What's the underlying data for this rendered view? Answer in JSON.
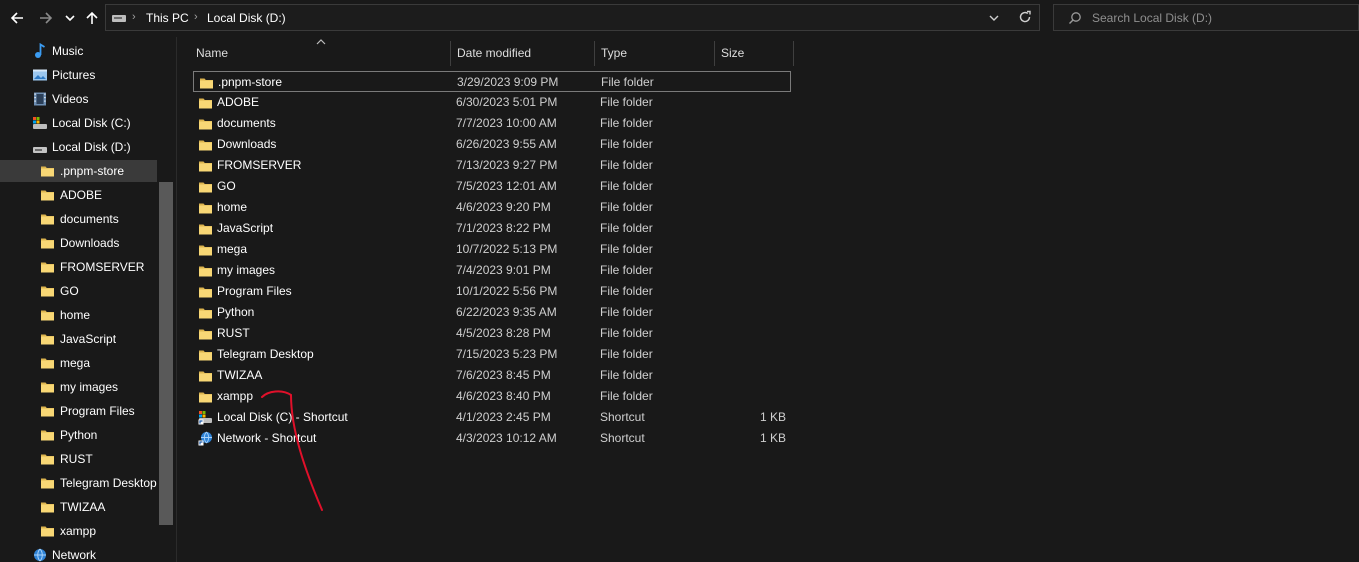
{
  "toolbar": {
    "back_icon": "arrow-left-icon",
    "forward_icon": "arrow-right-icon",
    "recent_icon": "chevron-down-icon",
    "up_icon": "arrow-up-icon"
  },
  "address_bar": {
    "crumbs": [
      "This PC",
      "Local Disk (D:)"
    ],
    "dropdown_icon": "chevron-down-icon",
    "refresh_icon": "refresh-icon"
  },
  "search": {
    "placeholder": "Search Local Disk (D:)"
  },
  "sidebar": {
    "items": [
      {
        "label": "Music",
        "icon": "music-icon",
        "level": 1
      },
      {
        "label": "Pictures",
        "icon": "pictures-icon",
        "level": 1
      },
      {
        "label": "Videos",
        "icon": "videos-icon",
        "level": 1
      },
      {
        "label": "Local Disk (C:)",
        "icon": "drive-c-icon",
        "level": 1
      },
      {
        "label": "Local Disk (D:)",
        "icon": "drive-icon",
        "level": 1
      },
      {
        "label": ".pnpm-store",
        "icon": "folder-icon",
        "level": 2,
        "selected": true
      },
      {
        "label": "ADOBE",
        "icon": "folder-icon",
        "level": 2
      },
      {
        "label": "documents",
        "icon": "folder-icon",
        "level": 2
      },
      {
        "label": "Downloads",
        "icon": "folder-icon",
        "level": 2
      },
      {
        "label": "FROMSERVER",
        "icon": "folder-icon",
        "level": 2
      },
      {
        "label": "GO",
        "icon": "folder-icon",
        "level": 2
      },
      {
        "label": "home",
        "icon": "folder-icon",
        "level": 2
      },
      {
        "label": "JavaScript",
        "icon": "folder-icon",
        "level": 2
      },
      {
        "label": "mega",
        "icon": "folder-icon",
        "level": 2
      },
      {
        "label": "my images",
        "icon": "folder-icon",
        "level": 2
      },
      {
        "label": "Program Files",
        "icon": "folder-icon",
        "level": 2
      },
      {
        "label": "Python",
        "icon": "folder-icon",
        "level": 2
      },
      {
        "label": "RUST",
        "icon": "folder-icon",
        "level": 2
      },
      {
        "label": "Telegram Desktop",
        "icon": "folder-icon",
        "level": 2
      },
      {
        "label": "TWIZAA",
        "icon": "folder-icon",
        "level": 2
      },
      {
        "label": "xampp",
        "icon": "folder-icon",
        "level": 2
      },
      {
        "label": "Network",
        "icon": "network-icon",
        "level": 1
      }
    ]
  },
  "columns": {
    "name": "Name",
    "date": "Date modified",
    "type": "Type",
    "size": "Size",
    "sort_icon": "sort-ascending-icon"
  },
  "files": [
    {
      "name": ".pnpm-store",
      "date": "3/29/2023 9:09 PM",
      "type": "File folder",
      "size": "",
      "icon": "folder-icon",
      "outlined": true
    },
    {
      "name": "ADOBE",
      "date": "6/30/2023 5:01 PM",
      "type": "File folder",
      "size": "",
      "icon": "folder-icon"
    },
    {
      "name": "documents",
      "date": "7/7/2023 10:00 AM",
      "type": "File folder",
      "size": "",
      "icon": "folder-icon"
    },
    {
      "name": "Downloads",
      "date": "6/26/2023 9:55 AM",
      "type": "File folder",
      "size": "",
      "icon": "folder-icon"
    },
    {
      "name": "FROMSERVER",
      "date": "7/13/2023 9:27 PM",
      "type": "File folder",
      "size": "",
      "icon": "folder-icon"
    },
    {
      "name": "GO",
      "date": "7/5/2023 12:01 AM",
      "type": "File folder",
      "size": "",
      "icon": "folder-icon"
    },
    {
      "name": "home",
      "date": "4/6/2023 9:20 PM",
      "type": "File folder",
      "size": "",
      "icon": "folder-icon"
    },
    {
      "name": "JavaScript",
      "date": "7/1/2023 8:22 PM",
      "type": "File folder",
      "size": "",
      "icon": "folder-icon"
    },
    {
      "name": "mega",
      "date": "10/7/2022 5:13 PM",
      "type": "File folder",
      "size": "",
      "icon": "folder-icon"
    },
    {
      "name": "my images",
      "date": "7/4/2023 9:01 PM",
      "type": "File folder",
      "size": "",
      "icon": "folder-icon"
    },
    {
      "name": "Program Files",
      "date": "10/1/2022 5:56 PM",
      "type": "File folder",
      "size": "",
      "icon": "folder-icon"
    },
    {
      "name": "Python",
      "date": "6/22/2023 9:35 AM",
      "type": "File folder",
      "size": "",
      "icon": "folder-icon"
    },
    {
      "name": "RUST",
      "date": "4/5/2023 8:28 PM",
      "type": "File folder",
      "size": "",
      "icon": "folder-icon"
    },
    {
      "name": "Telegram Desktop",
      "date": "7/15/2023 5:23 PM",
      "type": "File folder",
      "size": "",
      "icon": "folder-icon"
    },
    {
      "name": "TWIZAA",
      "date": "7/6/2023 8:45 PM",
      "type": "File folder",
      "size": "",
      "icon": "folder-icon"
    },
    {
      "name": "xampp",
      "date": "4/6/2023 8:40 PM",
      "type": "File folder",
      "size": "",
      "icon": "folder-icon"
    },
    {
      "name": "Local Disk (C) - Shortcut",
      "date": "4/1/2023 2:45 PM",
      "type": "Shortcut",
      "size": "1 KB",
      "icon": "drive-shortcut-icon"
    },
    {
      "name": "Network - Shortcut",
      "date": "4/3/2023 10:12 AM",
      "type": "Shortcut",
      "size": "1 KB",
      "icon": "network-shortcut-icon"
    }
  ],
  "colors": {
    "background": "#191919",
    "selection": "#3a3a3a",
    "folder": "#f8d775",
    "annotation": "#e0102a"
  }
}
